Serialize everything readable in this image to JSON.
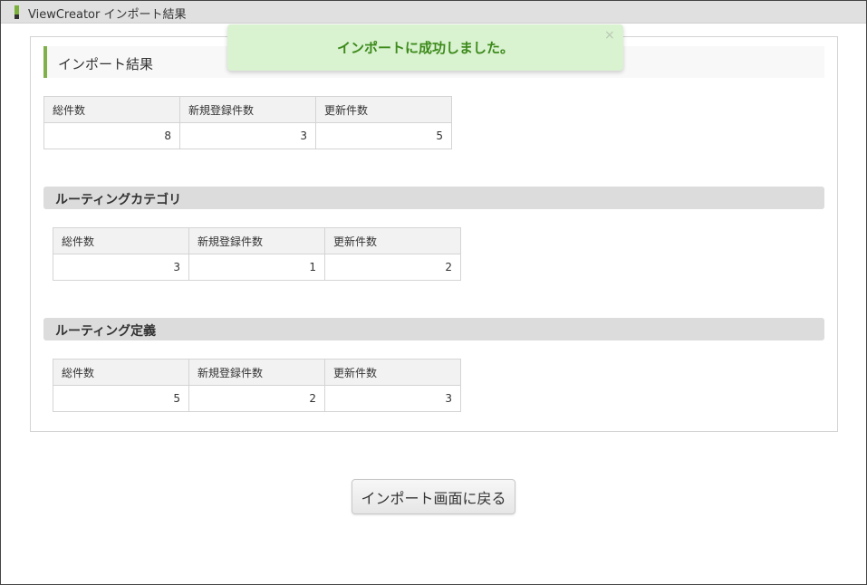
{
  "window": {
    "title": "ViewCreator インポート結果"
  },
  "toast": {
    "message": "インポートに成功しました。",
    "close": "×"
  },
  "main": {
    "heading": "インポート結果",
    "headers": [
      "総件数",
      "新規登録件数",
      "更新件数"
    ],
    "summary": {
      "values": [
        "8",
        "3",
        "5"
      ]
    },
    "sections": [
      {
        "title": "ルーティングカテゴリ",
        "values": [
          "3",
          "1",
          "2"
        ]
      },
      {
        "title": "ルーティング定義",
        "values": [
          "5",
          "2",
          "3"
        ]
      }
    ]
  },
  "footer": {
    "back_label": "インポート画面に戻る"
  },
  "colors": {
    "accent": "#7fb04a",
    "toast_bg": "#d9f2d0",
    "toast_text": "#3c8a1a"
  }
}
